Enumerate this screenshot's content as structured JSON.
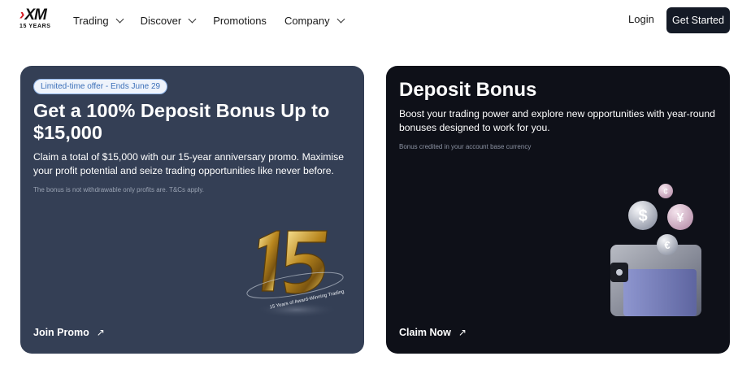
{
  "header": {
    "logo": {
      "mark": "XM",
      "sub": "15 YEARS"
    },
    "nav": [
      {
        "label": "Trading",
        "has_dropdown": true
      },
      {
        "label": "Discover",
        "has_dropdown": true
      },
      {
        "label": "Promotions",
        "has_dropdown": false
      },
      {
        "label": "Company",
        "has_dropdown": true
      }
    ],
    "login_label": "Login",
    "get_started_label": "Get Started"
  },
  "cards": [
    {
      "badge": "Limited-time offer - Ends June 29",
      "title": "Get a 100% Deposit Bonus Up to $15,000",
      "description": "Claim a total of $15,000 with our 15-year anniversary promo. Maximise your profit potential and seize trading opportunities like never before.",
      "fine_print": "The bonus is not withdrawable only profits are. T&Cs apply.",
      "cta_label": "Join Promo",
      "artwork": {
        "numeral": "15",
        "ring_text": "15 Years of Award-Winning Trading"
      }
    },
    {
      "title": "Deposit Bonus",
      "description": "Boost your trading power and explore new opportunities with year-round bonuses designed to work for you.",
      "fine_print": "Bonus credited in your account base currency",
      "cta_label": "Claim Now",
      "artwork": {
        "coins": [
          "$",
          "¥",
          "€",
          "¢"
        ]
      }
    }
  ],
  "colors": {
    "brand_red": "#d51b24",
    "card_left_bg": "#343f55",
    "card_right_bg": "#0e1018",
    "button_dark": "#141a26",
    "badge_text": "#3b6fb8",
    "gold": "#c9a227"
  },
  "icons": [
    "chevron-down-icon",
    "arrow-up-right-icon"
  ]
}
